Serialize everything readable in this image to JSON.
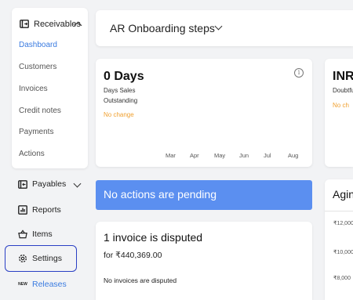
{
  "sidebar": {
    "receivables": {
      "label": "Receivables",
      "items": [
        {
          "label": "Dashboard",
          "active": true
        },
        {
          "label": "Customers"
        },
        {
          "label": "Invoices"
        },
        {
          "label": "Credit notes"
        },
        {
          "label": "Payments"
        },
        {
          "label": "Actions"
        }
      ]
    },
    "payables": {
      "label": "Payables"
    },
    "reports": {
      "label": "Reports"
    },
    "items": {
      "label": "Items"
    },
    "settings": {
      "label": "Settings"
    },
    "releases": {
      "label": "Releases",
      "badge": "NEW"
    }
  },
  "header": {
    "dropdown_label": "AR Onboarding steps"
  },
  "dso_card": {
    "value": "0 Days",
    "label_line1": "Days Sales",
    "label_line2": "Outstanding",
    "change": "No change",
    "months": [
      "Mar",
      "Apr",
      "May",
      "Jun",
      "Jul",
      "Aug"
    ]
  },
  "doubtful_card": {
    "value": "INR",
    "sub": "Doubtfu",
    "change": "No ch"
  },
  "actions_banner": {
    "text": "No actions are pending"
  },
  "disputes_card": {
    "title": "1 invoice is disputed",
    "amount": "for ₹440,369.00",
    "note": "No invoices are disputed"
  },
  "aging_card": {
    "title": "Agin",
    "ticks": [
      "₹12,000",
      "₹10,000",
      "₹8,000"
    ]
  },
  "colors": {
    "accent": "#3a7be0",
    "banner": "#5b8ff0",
    "warning": "#f0a030",
    "highlight_border": "#2a3fc4"
  }
}
